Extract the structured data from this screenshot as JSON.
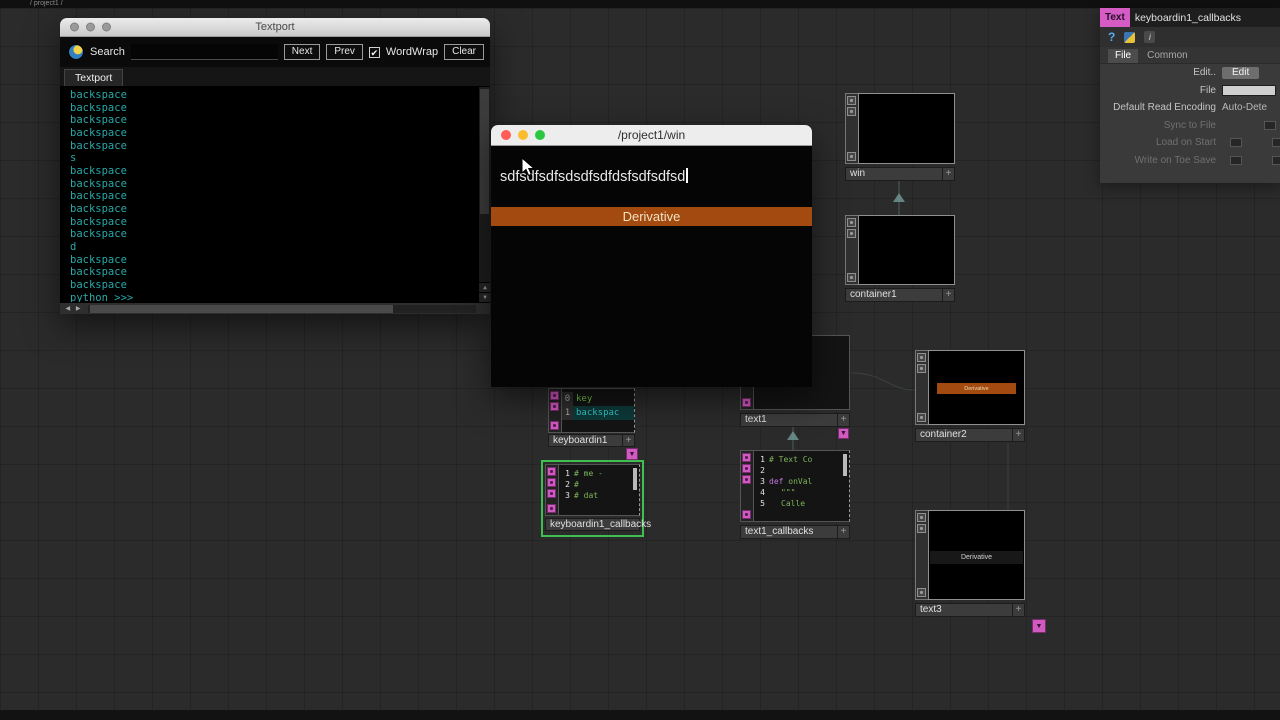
{
  "top_bar": {
    "path": "/ project1 /"
  },
  "textport": {
    "title": "Textport",
    "tab": "Textport",
    "search": {
      "label": "Search",
      "value": "",
      "next": "Next",
      "prev": "Prev",
      "wordwrap_label": "WordWrap",
      "clear": "Clear"
    },
    "console_lines": [
      "backspace",
      "backspace",
      "backspace",
      "backspace",
      "backspace",
      "s",
      "backspace",
      "backspace",
      "backspace",
      "backspace",
      "backspace",
      "backspace",
      "d",
      "backspace",
      "backspace",
      "backspace",
      "python >>>"
    ]
  },
  "win_window": {
    "title": "/project1/win",
    "typed_text": "sdfsdfsdfsdsdfsdfdsfsdfsdfsd",
    "menu_item": "Derivative",
    "menu_highlight_color": "#a24a10"
  },
  "param_panel": {
    "family": "Text",
    "name": "keyboardin1_callbacks",
    "tabs": [
      "File",
      "Common"
    ],
    "rows": [
      {
        "label": "Edit..",
        "value": "Edit"
      },
      {
        "label": "File",
        "value": ""
      },
      {
        "label": "Default Read Encoding",
        "value": "Auto-Dete"
      },
      {
        "label": "Sync to File",
        "value": ""
      },
      {
        "label": "Load on Start",
        "value": ""
      },
      {
        "label": "Write on Toe Save",
        "value": ""
      }
    ]
  },
  "nodes": {
    "win": {
      "label": "win"
    },
    "container1": {
      "label": "container1"
    },
    "container2": {
      "label": "container2",
      "viewer_text": "Derivative"
    },
    "text1": {
      "label": "text1"
    },
    "text3": {
      "label": "text3",
      "viewer_text": "Derivative"
    },
    "keyboardin1": {
      "label": "keyboardin1",
      "rows": [
        {
          "num": "0",
          "text": "key"
        },
        {
          "num": "1",
          "text": "backspac"
        }
      ]
    },
    "keyboardin1_callbacks": {
      "label": "keyboardin1_callbacks",
      "code": [
        {
          "num": "1",
          "text": "# me -"
        },
        {
          "num": "2",
          "text": "#"
        },
        {
          "num": "3",
          "text": "# dat"
        }
      ]
    },
    "text1_callbacks": {
      "label": "text1_callbacks",
      "code": [
        {
          "num": "1",
          "text": "# Text Co"
        },
        {
          "num": "2",
          "text": ""
        },
        {
          "num": "3",
          "kw": "def",
          "text": " onVal"
        },
        {
          "num": "4",
          "text": "\"\"\""
        },
        {
          "num": "5",
          "text": "Calle"
        }
      ]
    }
  },
  "icons": {
    "plus": "+",
    "check": "✔",
    "up_arrow": "▲",
    "down_arrow": "▼",
    "left_arrow": "◀",
    "right_arrow": "▶",
    "help": "?",
    "info": "i"
  }
}
